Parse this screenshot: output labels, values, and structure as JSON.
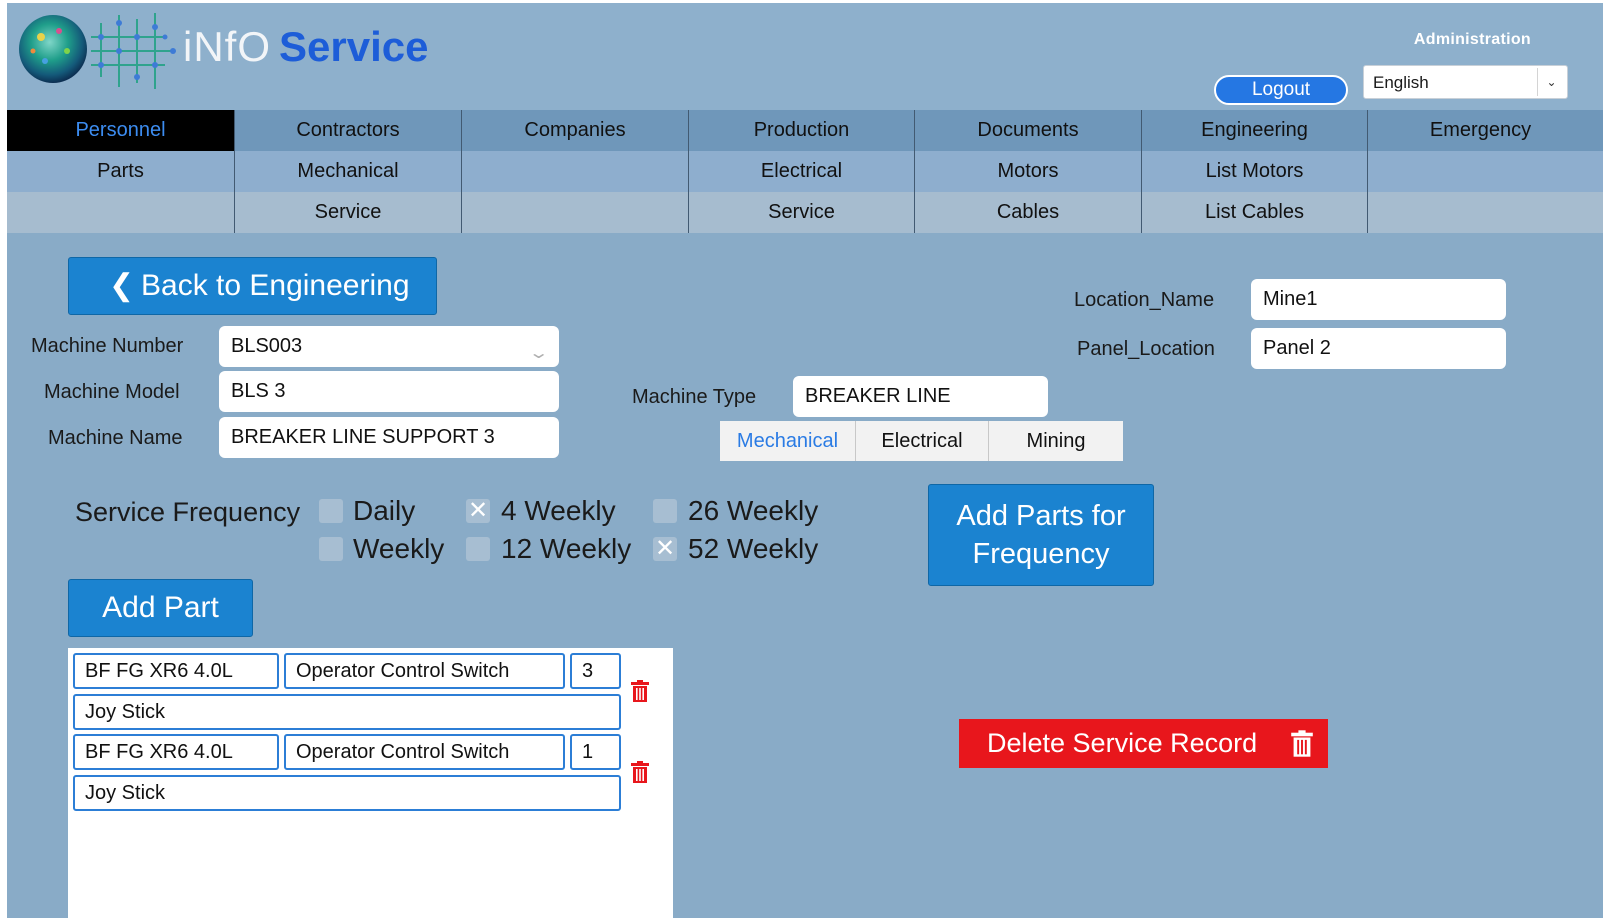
{
  "header": {
    "brand_part1": "iNfO",
    "brand_part2": "Service",
    "admin_label": "Administration",
    "logout_label": "Logout",
    "language": "English"
  },
  "nav": {
    "row1": [
      "Personnel",
      "Contractors",
      "Companies",
      "Production",
      "Documents",
      "Engineering",
      "Emergency"
    ],
    "row2": [
      "Parts",
      "Mechanical",
      "",
      "Electrical",
      "Motors",
      "List Motors",
      ""
    ],
    "row3": [
      "",
      "Service",
      "",
      "Service",
      "Cables",
      "List Cables",
      ""
    ],
    "active": "Personnel"
  },
  "back_button": "Back to Engineering",
  "form": {
    "machine_number_label": "Machine Number",
    "machine_number": "BLS003",
    "machine_model_label": "Machine Model",
    "machine_model": "BLS 3",
    "machine_name_label": "Machine Name",
    "machine_name": "BREAKER LINE SUPPORT 3",
    "location_name_label": "Location_Name",
    "location_name": "Mine1",
    "panel_location_label": "Panel_Location",
    "panel_location": "Panel 2",
    "machine_type_label": "Machine Type",
    "machine_type": "BREAKER LINE"
  },
  "segments": {
    "items": [
      "Mechanical",
      "Electrical",
      "Mining"
    ],
    "selected": "Mechanical"
  },
  "frequency": {
    "label": "Service Frequency",
    "options": [
      {
        "label": "Daily",
        "checked": false
      },
      {
        "label": "4 Weekly",
        "checked": true
      },
      {
        "label": "26 Weekly",
        "checked": false
      },
      {
        "label": "Weekly",
        "checked": false
      },
      {
        "label": "12 Weekly",
        "checked": false
      },
      {
        "label": "52 Weekly",
        "checked": true
      }
    ]
  },
  "add_parts_for_frequency": [
    "Add Parts for",
    "Frequency"
  ],
  "add_part_button": "Add Part",
  "parts": [
    {
      "part_no": "BF FG XR6 4.0L",
      "description": "Operator Control Switch",
      "qty": "3",
      "note": "Joy Stick"
    },
    {
      "part_no": "BF FG XR6 4.0L",
      "description": "Operator Control Switch",
      "qty": "1",
      "note": "Joy Stick"
    }
  ],
  "delete_button": "Delete Service Record",
  "colors": {
    "background": "#89abc7",
    "accent_button": "#1b83d0",
    "danger": "#e8161c",
    "brand_blue": "#1d5dd8"
  }
}
